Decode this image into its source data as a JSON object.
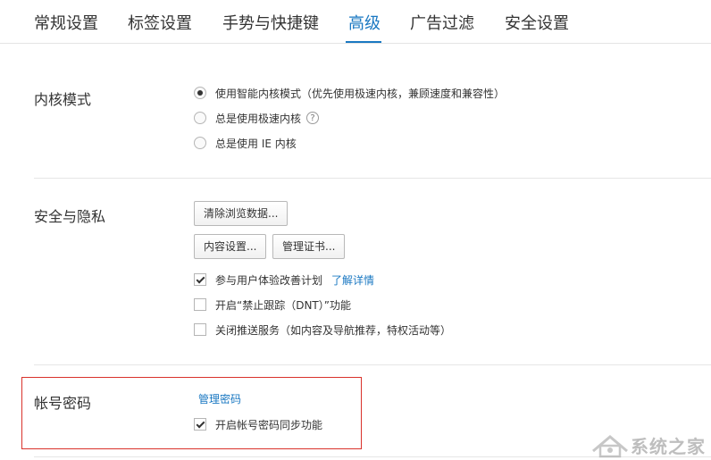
{
  "tabs": [
    {
      "label": "常规设置"
    },
    {
      "label": "标签设置"
    },
    {
      "label": "手势与快捷键"
    },
    {
      "label": "高级"
    },
    {
      "label": "广告过滤"
    },
    {
      "label": "安全设置"
    }
  ],
  "active_tab": "高级",
  "kernel": {
    "title": "内核模式",
    "options": [
      {
        "label": "使用智能内核模式（优先使用极速内核，兼顾速度和兼容性）",
        "selected": true
      },
      {
        "label": "总是使用极速内核",
        "selected": false
      },
      {
        "label": "总是使用 IE 内核",
        "selected": false
      }
    ],
    "help_glyph": "?"
  },
  "privacy": {
    "title": "安全与隐私",
    "clear_button": "清除浏览数据...",
    "content_button": "内容设置...",
    "cert_button": "管理证书...",
    "checks": [
      {
        "label": "参与用户体验改善计划",
        "checked": true,
        "link": "了解详情"
      },
      {
        "label": "开启“禁止跟踪（DNT）”功能",
        "checked": false
      },
      {
        "label": "关闭推送服务（如内容及导航推荐，特权活动等）",
        "checked": false
      }
    ]
  },
  "account": {
    "title": "帐号密码",
    "manage_link": "管理密码",
    "sync_check": {
      "label": "开启帐号密码同步功能",
      "checked": true
    }
  },
  "colors": {
    "accent": "#1a78c2",
    "highlight": "#d9322b"
  },
  "watermark": {
    "text": "系统之家"
  }
}
